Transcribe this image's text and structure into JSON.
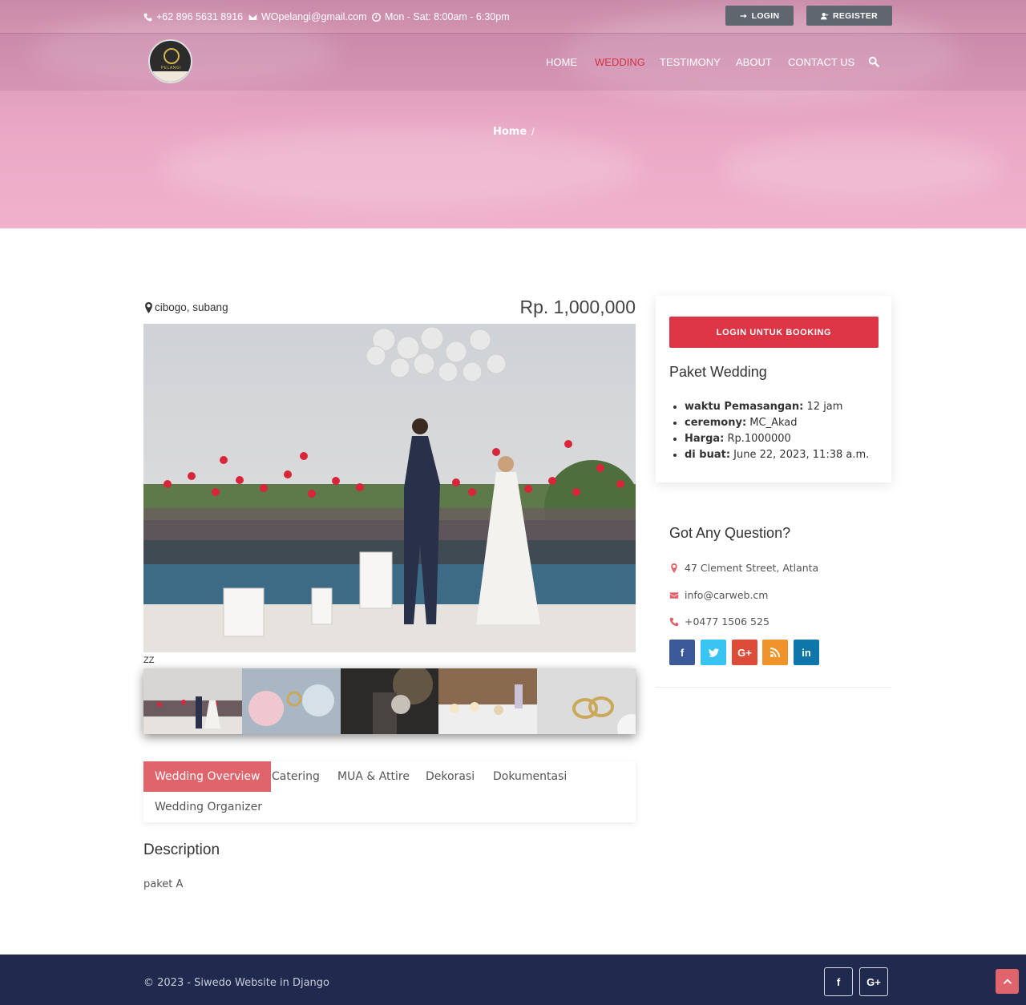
{
  "topbar": {
    "phone": "+62 896 5631 8916",
    "email": "WOpelangi@gmail.com",
    "hours": "Mon - Sat: 8:00am - 6:30pm",
    "login_label": "LOGIN",
    "register_label": "REGISTER"
  },
  "logo": {
    "text": "PELANGI"
  },
  "nav": {
    "items": [
      {
        "label": "HOME",
        "active": false
      },
      {
        "label": "WEDDING",
        "active": true
      },
      {
        "label": "TESTIMONY",
        "active": false
      },
      {
        "label": "ABOUT",
        "active": false
      },
      {
        "label": "CONTACT US",
        "active": false
      }
    ]
  },
  "breadcrumb": {
    "home": "Home",
    "separator": "/"
  },
  "listing": {
    "location": "cibogo, subang",
    "price": "Rp. 1,000,000",
    "image_caption": "ZZ"
  },
  "tabs": [
    {
      "label": "Wedding Overview",
      "active": true
    },
    {
      "label": "Catering",
      "active": false
    },
    {
      "label": "MUA & Attire",
      "active": false
    },
    {
      "label": "Dekorasi",
      "active": false
    },
    {
      "label": "Dokumentasi",
      "active": false
    },
    {
      "label": "Wedding Organizer",
      "active": false
    }
  ],
  "description": {
    "title": "Description",
    "text": "paket A"
  },
  "sidebar": {
    "book_label": "LOGIN UNTUK BOOKING",
    "package_title": "Paket Wedding",
    "details": [
      {
        "label": "waktu Pemasangan:",
        "value": " 12 jam"
      },
      {
        "label": "ceremony:",
        "value": " MC_Akad"
      },
      {
        "label": "Harga:",
        "value": " Rp.1000000"
      },
      {
        "label": "di buat:",
        "value": " June 22, 2023, 11:38 a.m."
      }
    ],
    "question_title": "Got Any Question?",
    "address": "47 Clement Street, Atlanta",
    "contact_email": "info@carweb.cm",
    "contact_phone": "+0477 1506 525"
  },
  "footer": {
    "copyright": "© 2023 - Siwedo Website in Django"
  },
  "colors": {
    "accent": "#dc3545",
    "tab_active": "#e0646c",
    "footer_bg": "#1f2a4e",
    "nav_active": "#d2323f"
  }
}
